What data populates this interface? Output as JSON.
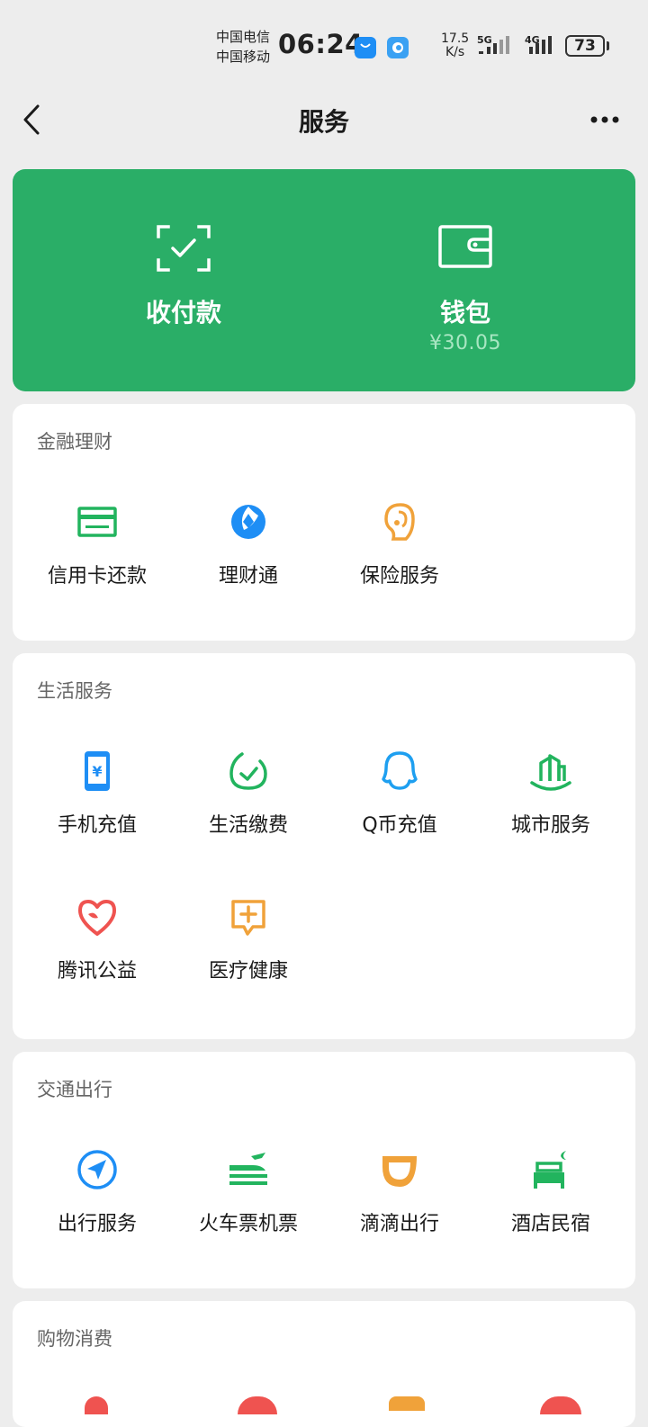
{
  "status_bar": {
    "carrier_1": "中国电信",
    "carrier_2": "中国移动",
    "time": "06:24",
    "net_speed_value": "17.5",
    "net_speed_unit": "K/s",
    "network_1": "5G",
    "network_2": "4G",
    "battery": "73"
  },
  "nav": {
    "title": "服务",
    "back_icon": "chevron-left-icon",
    "more_icon": "more-dots-icon"
  },
  "hero": {
    "pay": {
      "label": "收付款",
      "icon": "scan-check-icon"
    },
    "wallet": {
      "label": "钱包",
      "balance": "¥30.05",
      "icon": "wallet-icon"
    },
    "background": "#2aae67"
  },
  "sections": {
    "finance": {
      "title": "金融理财",
      "items": [
        {
          "label": "信用卡还款",
          "icon": "credit-card-icon"
        },
        {
          "label": "理财通",
          "icon": "wealth-icon"
        },
        {
          "label": "保险服务",
          "icon": "insurance-icon"
        }
      ]
    },
    "life": {
      "title": "生活服务",
      "items": [
        {
          "label": "手机充值",
          "icon": "phone-recharge-icon"
        },
        {
          "label": "生活缴费",
          "icon": "utility-payment-icon"
        },
        {
          "label": "Q币充值",
          "icon": "qq-coin-icon"
        },
        {
          "label": "城市服务",
          "icon": "city-service-icon"
        },
        {
          "label": "腾讯公益",
          "icon": "charity-heart-icon"
        },
        {
          "label": "医疗健康",
          "icon": "medical-icon"
        }
      ]
    },
    "transport": {
      "title": "交通出行",
      "items": [
        {
          "label": "出行服务",
          "icon": "travel-compass-icon"
        },
        {
          "label": "火车票机票",
          "icon": "train-plane-icon"
        },
        {
          "label": "滴滴出行",
          "icon": "didi-icon"
        },
        {
          "label": "酒店民宿",
          "icon": "hotel-bed-icon"
        }
      ]
    },
    "shopping": {
      "title": "购物消费"
    }
  },
  "colors": {
    "green": "#2aae67",
    "blue": "#1e8ef5",
    "orange": "#f0a23a",
    "red": "#ef5350",
    "icon_green": "#22b45e"
  }
}
